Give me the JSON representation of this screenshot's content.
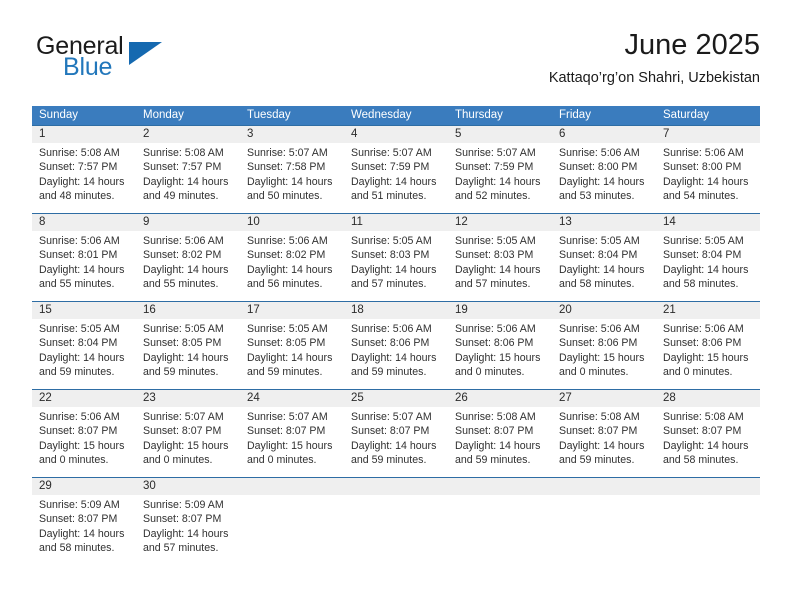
{
  "brand": {
    "name_top": "General",
    "name_bottom": "Blue",
    "triangle_color": "#1569b0",
    "blue_text_color": "#2277bb"
  },
  "header": {
    "title": "June 2025",
    "subtitle": "Kattaqo’rg’on Shahri, Uzbekistan"
  },
  "calendar": {
    "header_bg": "#3a7cbe",
    "row_divider_color": "#2e6da4",
    "daynum_bg": "#efefef",
    "weekdays": [
      "Sunday",
      "Monday",
      "Tuesday",
      "Wednesday",
      "Thursday",
      "Friday",
      "Saturday"
    ],
    "weeks": [
      {
        "days": [
          {
            "num": "1",
            "sunrise": "Sunrise: 5:08 AM",
            "sunset": "Sunset: 7:57 PM",
            "daylight1": "Daylight: 14 hours",
            "daylight2": "and 48 minutes."
          },
          {
            "num": "2",
            "sunrise": "Sunrise: 5:08 AM",
            "sunset": "Sunset: 7:57 PM",
            "daylight1": "Daylight: 14 hours",
            "daylight2": "and 49 minutes."
          },
          {
            "num": "3",
            "sunrise": "Sunrise: 5:07 AM",
            "sunset": "Sunset: 7:58 PM",
            "daylight1": "Daylight: 14 hours",
            "daylight2": "and 50 minutes."
          },
          {
            "num": "4",
            "sunrise": "Sunrise: 5:07 AM",
            "sunset": "Sunset: 7:59 PM",
            "daylight1": "Daylight: 14 hours",
            "daylight2": "and 51 minutes."
          },
          {
            "num": "5",
            "sunrise": "Sunrise: 5:07 AM",
            "sunset": "Sunset: 7:59 PM",
            "daylight1": "Daylight: 14 hours",
            "daylight2": "and 52 minutes."
          },
          {
            "num": "6",
            "sunrise": "Sunrise: 5:06 AM",
            "sunset": "Sunset: 8:00 PM",
            "daylight1": "Daylight: 14 hours",
            "daylight2": "and 53 minutes."
          },
          {
            "num": "7",
            "sunrise": "Sunrise: 5:06 AM",
            "sunset": "Sunset: 8:00 PM",
            "daylight1": "Daylight: 14 hours",
            "daylight2": "and 54 minutes."
          }
        ]
      },
      {
        "days": [
          {
            "num": "8",
            "sunrise": "Sunrise: 5:06 AM",
            "sunset": "Sunset: 8:01 PM",
            "daylight1": "Daylight: 14 hours",
            "daylight2": "and 55 minutes."
          },
          {
            "num": "9",
            "sunrise": "Sunrise: 5:06 AM",
            "sunset": "Sunset: 8:02 PM",
            "daylight1": "Daylight: 14 hours",
            "daylight2": "and 55 minutes."
          },
          {
            "num": "10",
            "sunrise": "Sunrise: 5:06 AM",
            "sunset": "Sunset: 8:02 PM",
            "daylight1": "Daylight: 14 hours",
            "daylight2": "and 56 minutes."
          },
          {
            "num": "11",
            "sunrise": "Sunrise: 5:05 AM",
            "sunset": "Sunset: 8:03 PM",
            "daylight1": "Daylight: 14 hours",
            "daylight2": "and 57 minutes."
          },
          {
            "num": "12",
            "sunrise": "Sunrise: 5:05 AM",
            "sunset": "Sunset: 8:03 PM",
            "daylight1": "Daylight: 14 hours",
            "daylight2": "and 57 minutes."
          },
          {
            "num": "13",
            "sunrise": "Sunrise: 5:05 AM",
            "sunset": "Sunset: 8:04 PM",
            "daylight1": "Daylight: 14 hours",
            "daylight2": "and 58 minutes."
          },
          {
            "num": "14",
            "sunrise": "Sunrise: 5:05 AM",
            "sunset": "Sunset: 8:04 PM",
            "daylight1": "Daylight: 14 hours",
            "daylight2": "and 58 minutes."
          }
        ]
      },
      {
        "days": [
          {
            "num": "15",
            "sunrise": "Sunrise: 5:05 AM",
            "sunset": "Sunset: 8:04 PM",
            "daylight1": "Daylight: 14 hours",
            "daylight2": "and 59 minutes."
          },
          {
            "num": "16",
            "sunrise": "Sunrise: 5:05 AM",
            "sunset": "Sunset: 8:05 PM",
            "daylight1": "Daylight: 14 hours",
            "daylight2": "and 59 minutes."
          },
          {
            "num": "17",
            "sunrise": "Sunrise: 5:05 AM",
            "sunset": "Sunset: 8:05 PM",
            "daylight1": "Daylight: 14 hours",
            "daylight2": "and 59 minutes."
          },
          {
            "num": "18",
            "sunrise": "Sunrise: 5:06 AM",
            "sunset": "Sunset: 8:06 PM",
            "daylight1": "Daylight: 14 hours",
            "daylight2": "and 59 minutes."
          },
          {
            "num": "19",
            "sunrise": "Sunrise: 5:06 AM",
            "sunset": "Sunset: 8:06 PM",
            "daylight1": "Daylight: 15 hours",
            "daylight2": "and 0 minutes."
          },
          {
            "num": "20",
            "sunrise": "Sunrise: 5:06 AM",
            "sunset": "Sunset: 8:06 PM",
            "daylight1": "Daylight: 15 hours",
            "daylight2": "and 0 minutes."
          },
          {
            "num": "21",
            "sunrise": "Sunrise: 5:06 AM",
            "sunset": "Sunset: 8:06 PM",
            "daylight1": "Daylight: 15 hours",
            "daylight2": "and 0 minutes."
          }
        ]
      },
      {
        "days": [
          {
            "num": "22",
            "sunrise": "Sunrise: 5:06 AM",
            "sunset": "Sunset: 8:07 PM",
            "daylight1": "Daylight: 15 hours",
            "daylight2": "and 0 minutes."
          },
          {
            "num": "23",
            "sunrise": "Sunrise: 5:07 AM",
            "sunset": "Sunset: 8:07 PM",
            "daylight1": "Daylight: 15 hours",
            "daylight2": "and 0 minutes."
          },
          {
            "num": "24",
            "sunrise": "Sunrise: 5:07 AM",
            "sunset": "Sunset: 8:07 PM",
            "daylight1": "Daylight: 15 hours",
            "daylight2": "and 0 minutes."
          },
          {
            "num": "25",
            "sunrise": "Sunrise: 5:07 AM",
            "sunset": "Sunset: 8:07 PM",
            "daylight1": "Daylight: 14 hours",
            "daylight2": "and 59 minutes."
          },
          {
            "num": "26",
            "sunrise": "Sunrise: 5:08 AM",
            "sunset": "Sunset: 8:07 PM",
            "daylight1": "Daylight: 14 hours",
            "daylight2": "and 59 minutes."
          },
          {
            "num": "27",
            "sunrise": "Sunrise: 5:08 AM",
            "sunset": "Sunset: 8:07 PM",
            "daylight1": "Daylight: 14 hours",
            "daylight2": "and 59 minutes."
          },
          {
            "num": "28",
            "sunrise": "Sunrise: 5:08 AM",
            "sunset": "Sunset: 8:07 PM",
            "daylight1": "Daylight: 14 hours",
            "daylight2": "and 58 minutes."
          }
        ]
      },
      {
        "days": [
          {
            "num": "29",
            "sunrise": "Sunrise: 5:09 AM",
            "sunset": "Sunset: 8:07 PM",
            "daylight1": "Daylight: 14 hours",
            "daylight2": "and 58 minutes."
          },
          {
            "num": "30",
            "sunrise": "Sunrise: 5:09 AM",
            "sunset": "Sunset: 8:07 PM",
            "daylight1": "Daylight: 14 hours",
            "daylight2": "and 57 minutes."
          },
          {
            "num": "",
            "sunrise": "",
            "sunset": "",
            "daylight1": "",
            "daylight2": ""
          },
          {
            "num": "",
            "sunrise": "",
            "sunset": "",
            "daylight1": "",
            "daylight2": ""
          },
          {
            "num": "",
            "sunrise": "",
            "sunset": "",
            "daylight1": "",
            "daylight2": ""
          },
          {
            "num": "",
            "sunrise": "",
            "sunset": "",
            "daylight1": "",
            "daylight2": ""
          },
          {
            "num": "",
            "sunrise": "",
            "sunset": "",
            "daylight1": "",
            "daylight2": ""
          }
        ]
      }
    ]
  }
}
